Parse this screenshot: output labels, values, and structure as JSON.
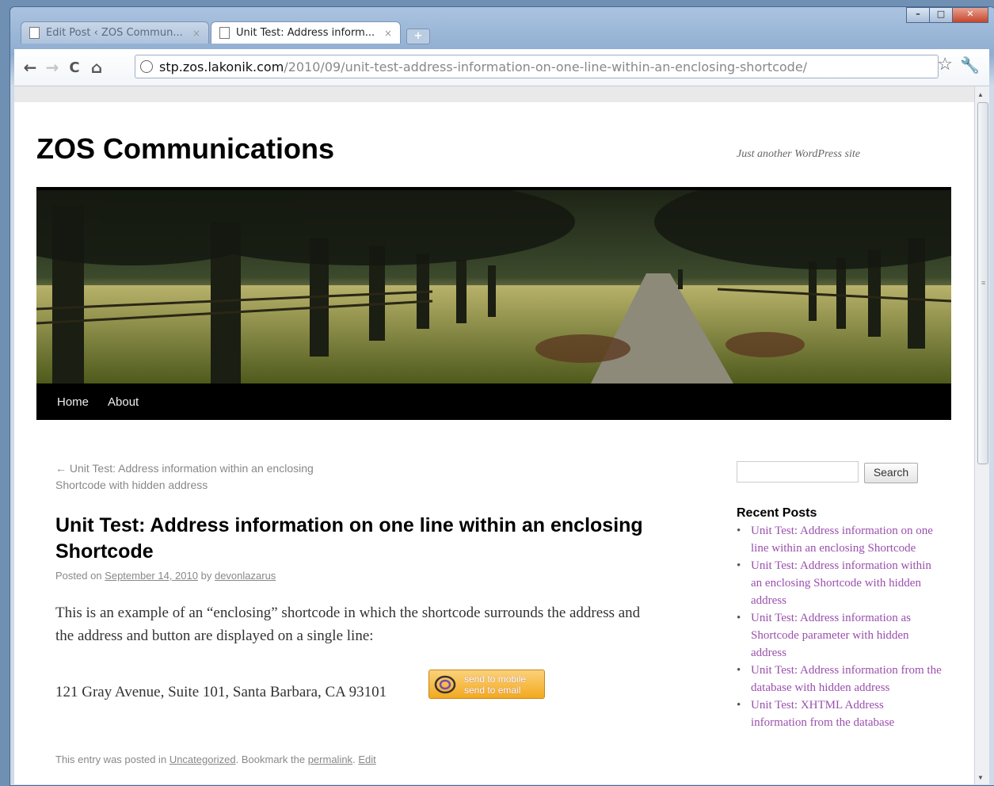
{
  "browser": {
    "tabs": [
      {
        "label": "Edit Post ‹ ZOS Commun...",
        "active": false
      },
      {
        "label": "Unit Test: Address inform...",
        "active": true
      }
    ],
    "close_glyph": "×",
    "new_tab_glyph": "+",
    "window_buttons": [
      "–",
      "□",
      "✕"
    ],
    "nav": {
      "back": "←",
      "forward": "→",
      "reload": "C",
      "home": "⌂"
    },
    "url_host": "stp.zos.lakonik.com",
    "url_path": "/2010/09/unit-test-address-information-on-one-line-within-an-enclosing-shortcode/",
    "star_glyph": "☆",
    "wrench_glyph": "🔧"
  },
  "site": {
    "title": "ZOS Communications",
    "description": "Just another WordPress site",
    "menu": [
      "Home",
      "About"
    ]
  },
  "post": {
    "prev_link": "← Unit Test: Address information within an enclosing Shortcode with hidden address",
    "title": "Unit Test: Address information on one line within an enclosing Shortcode",
    "meta": {
      "posted_on": "Posted on",
      "date": "September 14, 2010",
      "by": "by",
      "author": "devonlazarus"
    },
    "paragraph": "This is an example of an “enclosing” shortcode in which the shortcode surrounds the address and the address and button are displayed on a single line:",
    "address": "121 Gray Avenue, Suite 101, Santa Barbara, CA 93101",
    "send_button": {
      "line1": "send to mobile",
      "line2": "send to email"
    },
    "utility": {
      "prefix": "This entry was posted in",
      "category": "Uncategorized",
      "bookmark": ". Bookmark the",
      "permalink": "permalink",
      "sep": ".",
      "edit": "Edit"
    }
  },
  "sidebar": {
    "search_button": "Search",
    "recent_title": "Recent Posts",
    "recent_posts": [
      "Unit Test: Address information on one line within an enclosing Shortcode",
      "Unit Test: Address information within an enclosing Shortcode with hidden address",
      "Unit Test: Address information as Shortcode parameter with hidden address",
      "Unit Test: Address information from the database with hidden address",
      "Unit Test: XHTML Address information from the database"
    ]
  },
  "colors": {
    "link_purple": "#9b4fae",
    "menu_bar": "#000000",
    "send_button": "#f3a91e"
  }
}
